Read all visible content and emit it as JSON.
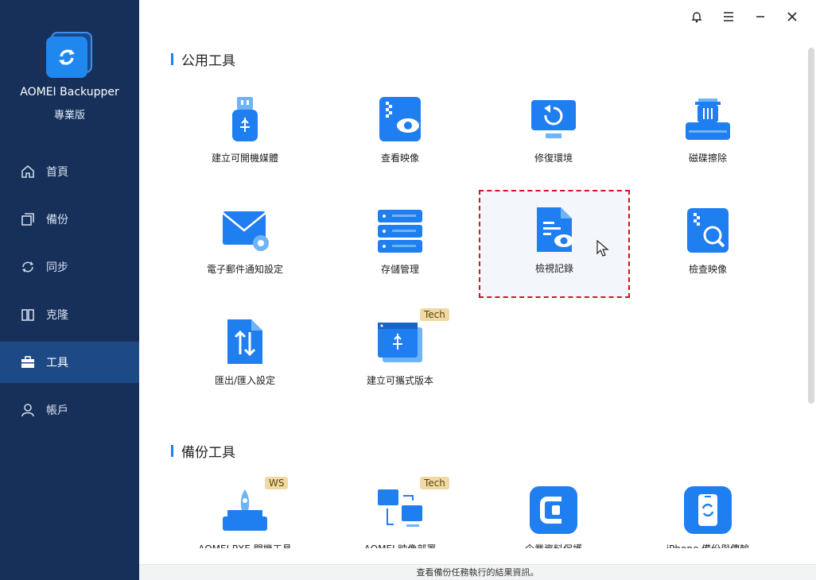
{
  "app": {
    "name": "AOMEI Backupper",
    "edition": "專業版"
  },
  "sidebar": {
    "items": [
      {
        "label": "首頁",
        "icon": "home-icon"
      },
      {
        "label": "備份",
        "icon": "backup-icon"
      },
      {
        "label": "同步",
        "icon": "sync-icon"
      },
      {
        "label": "克隆",
        "icon": "clone-icon"
      },
      {
        "label": "工具",
        "icon": "toolbox-icon",
        "active": true
      },
      {
        "label": "帳戶",
        "icon": "user-icon"
      }
    ]
  },
  "sections": {
    "common": {
      "title": "公用工具"
    },
    "backup": {
      "title": "備份工具"
    }
  },
  "tools_common": [
    {
      "label": "建立可開機媒體",
      "icon": "usb-icon"
    },
    {
      "label": "查看映像",
      "icon": "view-image-icon"
    },
    {
      "label": "修復環境",
      "icon": "recovery-env-icon"
    },
    {
      "label": "磁碟擦除",
      "icon": "disk-wipe-icon"
    },
    {
      "label": "電子郵件通知設定",
      "icon": "email-settings-icon"
    },
    {
      "label": "存儲管理",
      "icon": "storage-icon"
    },
    {
      "label": "檢視記錄",
      "icon": "view-logs-icon",
      "selected": true
    },
    {
      "label": "檢查映像",
      "icon": "check-image-icon"
    },
    {
      "label": "匯出/匯入設定",
      "icon": "export-import-icon"
    },
    {
      "label": "建立可攜式版本",
      "icon": "portable-icon",
      "badge": "Tech"
    }
  ],
  "tools_backup": [
    {
      "label": "AOMEI PXE 開機工具",
      "icon": "pxe-icon",
      "badge": "WS"
    },
    {
      "label": "AOMEI 映像部署",
      "icon": "image-deploy-icon",
      "badge": "Tech"
    },
    {
      "label": "企業資料保護",
      "icon": "centralized-icon"
    },
    {
      "label": "iPhone 備份與傳輸",
      "icon": "iphone-backup-icon"
    }
  ],
  "status_text": "查看備份任務執行的結果資訊。",
  "colors": {
    "sidebar": "#16305a",
    "accent": "#1f7ef0",
    "selected_border": "#d0141e",
    "badge_bg": "#f1d9a3"
  }
}
